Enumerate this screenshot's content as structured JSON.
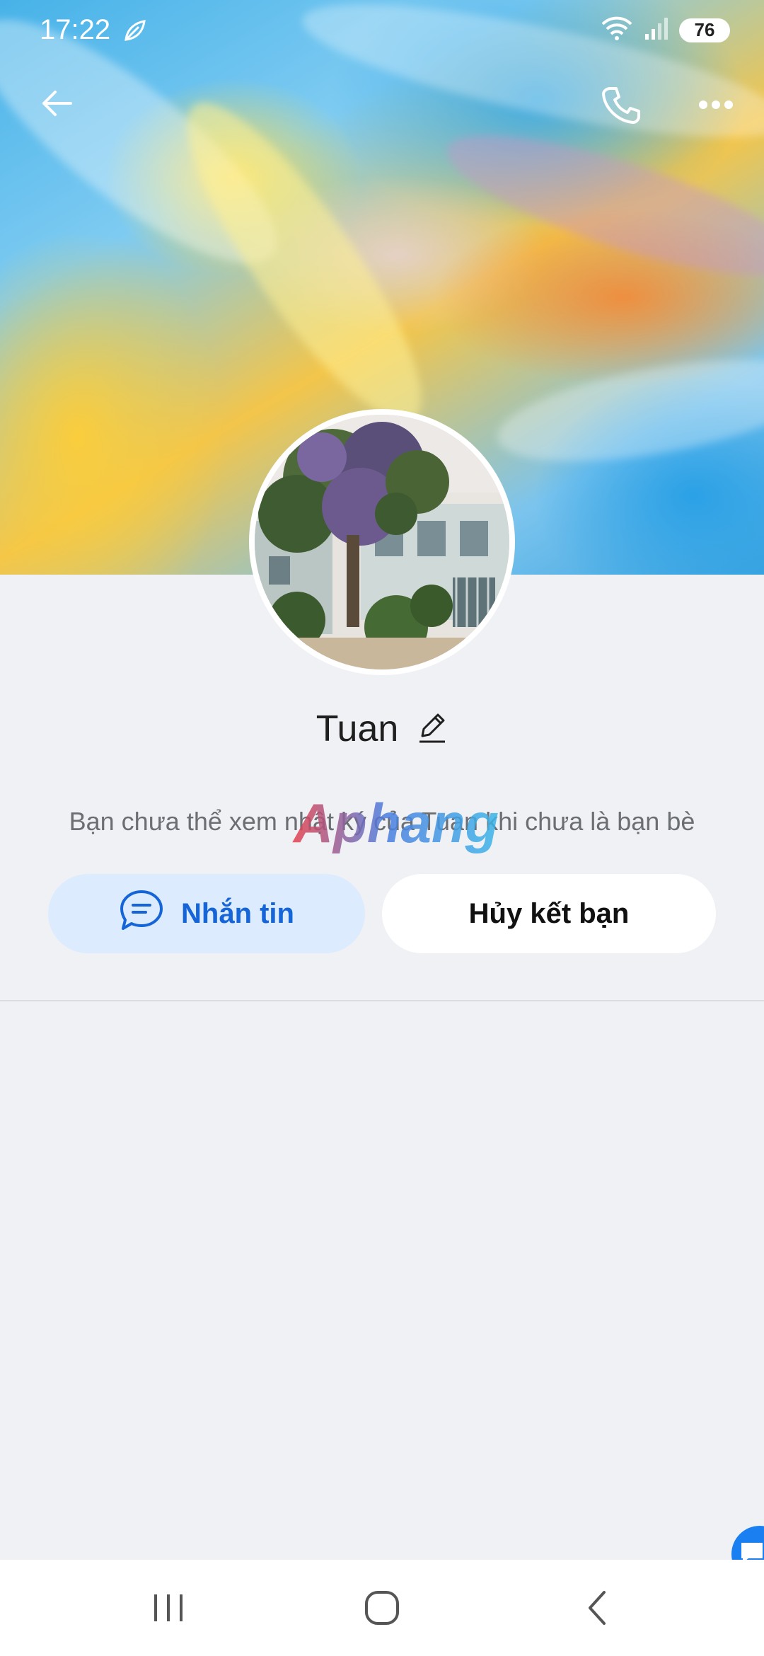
{
  "status_bar": {
    "time": "17:22",
    "battery": "76"
  },
  "header": {
    "back_icon": "arrow-left-icon",
    "call_icon": "phone-icon",
    "more_icon": "more-dots-icon"
  },
  "profile": {
    "name": "Tuan",
    "edit_icon": "pencil-icon",
    "info_text": "Bạn chưa thể xem nhật ký của Tuan khi chưa là bạn bè"
  },
  "actions": {
    "message_label": "Nhắn tin",
    "unfriend_label": "Hủy kết bạn"
  },
  "watermark": "Aphang",
  "colors": {
    "accent": "#1565d8",
    "message_bg": "#dcebfd",
    "page_bg": "#f0f1f5"
  },
  "nav": {
    "recents_icon": "recents-icon",
    "home_icon": "home-icon",
    "back_icon": "nav-back-icon"
  }
}
